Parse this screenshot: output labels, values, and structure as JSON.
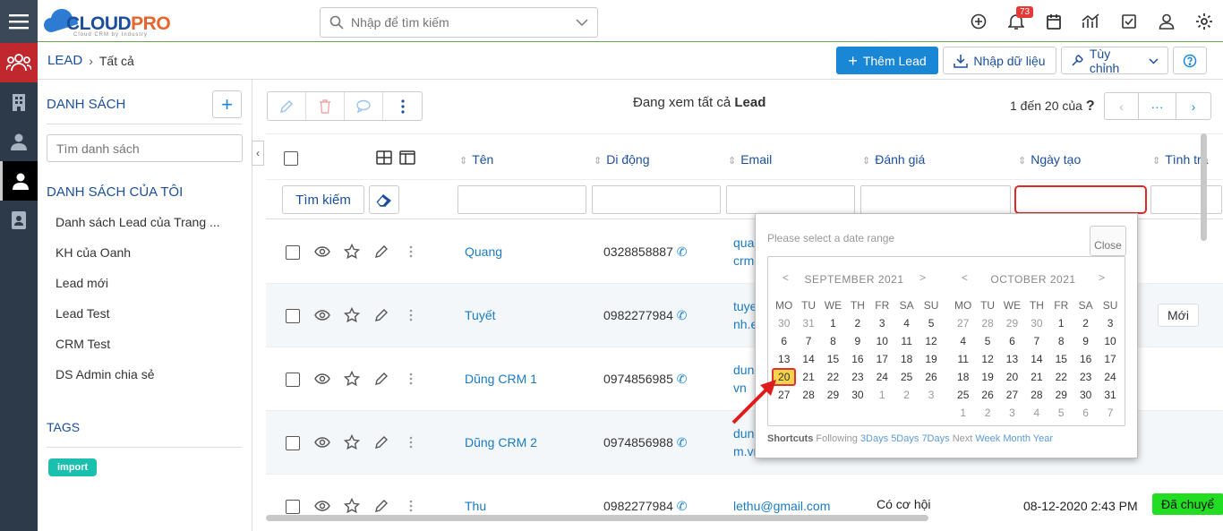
{
  "app": {
    "logo_main": "CLOUD",
    "logo_accent": "PRO",
    "logo_tagline": "Cloud CRM by Industry"
  },
  "search": {
    "placeholder": "Nhập để tìm kiếm"
  },
  "topbar": {
    "notification_count": "73"
  },
  "breadcrumb": {
    "root": "LEAD",
    "current": "Tất cả"
  },
  "toolbar": {
    "add_label": "Thêm Lead",
    "import_label": "Nhập dữ liệu",
    "custom_label": "Tùy chỉnh"
  },
  "sidebar": {
    "title": "DANH SÁCH",
    "search_placeholder": "Tìm danh sách",
    "my_lists_title": "DANH SÁCH CỦA TÔI",
    "items": [
      {
        "label": "Danh sách Lead của Trang ..."
      },
      {
        "label": "KH của Oanh"
      },
      {
        "label": "Lead mới"
      },
      {
        "label": "Lead Test"
      },
      {
        "label": "CRM Test"
      },
      {
        "label": "DS Admin chia sẻ"
      }
    ],
    "tags_title": "TAGS",
    "tag": "import"
  },
  "main": {
    "viewing_prefix": "Đang xem tất cả",
    "viewing_entity": "Lead",
    "pagination": "1 đến 20 của",
    "pagination_unknown": "?",
    "pagination_more": "···",
    "find_label": "Tìm kiếm"
  },
  "columns": {
    "name": "Tên",
    "mobile": "Di động",
    "email": "Email",
    "rating": "Đánh giá",
    "created": "Ngày tạo",
    "status": "Tình trạ"
  },
  "rows": [
    {
      "name": "Quang",
      "phone": "0328858887",
      "email1": "qua",
      "email2": "crm",
      "rating": "",
      "created": "",
      "status": ""
    },
    {
      "name": "Tuyết",
      "phone": "0982277984",
      "email1": "tuye",
      "email2": "nh.e",
      "rating": "",
      "created": "",
      "status": "Mới"
    },
    {
      "name": "Dũng CRM 1",
      "phone": "0974856985",
      "email1": "dun",
      "email2": "vn",
      "rating": "",
      "created": "",
      "status": ""
    },
    {
      "name": "Dũng CRM 2",
      "phone": "0974856988",
      "email1": "dun",
      "email2": "m.vn",
      "rating": "",
      "created": "",
      "status": ""
    },
    {
      "name": "Thu",
      "phone": "0982277984",
      "email1": "lethu@gmail.com",
      "email2": "",
      "rating": "Có cơ hội",
      "created": "08-12-2020 2:43 PM",
      "status": "Đã chuyể"
    }
  ],
  "datepicker": {
    "prompt": "Please select a date range",
    "close": "Close",
    "prev": "<",
    "next": ">",
    "weekdays": [
      "MO",
      "TU",
      "WE",
      "TH",
      "FR",
      "SA",
      "SU"
    ],
    "months": [
      {
        "title": "SEPTEMBER 2021",
        "days": [
          [
            "30",
            "off"
          ],
          [
            "31",
            "off"
          ],
          [
            "1",
            ""
          ],
          [
            "2",
            ""
          ],
          [
            "3",
            ""
          ],
          [
            "4",
            ""
          ],
          [
            "5",
            ""
          ],
          [
            "6",
            ""
          ],
          [
            "7",
            ""
          ],
          [
            "8",
            ""
          ],
          [
            "9",
            ""
          ],
          [
            "10",
            ""
          ],
          [
            "11",
            ""
          ],
          [
            "12",
            ""
          ],
          [
            "13",
            ""
          ],
          [
            "14",
            ""
          ],
          [
            "15",
            ""
          ],
          [
            "16",
            ""
          ],
          [
            "17",
            ""
          ],
          [
            "18",
            ""
          ],
          [
            "19",
            ""
          ],
          [
            "20",
            "sel"
          ],
          [
            "21",
            ""
          ],
          [
            "22",
            ""
          ],
          [
            "23",
            ""
          ],
          [
            "24",
            ""
          ],
          [
            "25",
            ""
          ],
          [
            "26",
            ""
          ],
          [
            "27",
            ""
          ],
          [
            "28",
            ""
          ],
          [
            "29",
            ""
          ],
          [
            "30",
            ""
          ],
          [
            "1",
            "off"
          ],
          [
            "2",
            "off"
          ],
          [
            "3",
            "off"
          ]
        ]
      },
      {
        "title": "OCTOBER 2021",
        "days": [
          [
            "27",
            "off"
          ],
          [
            "28",
            "off"
          ],
          [
            "29",
            "off"
          ],
          [
            "30",
            "off"
          ],
          [
            "1",
            ""
          ],
          [
            "2",
            ""
          ],
          [
            "3",
            ""
          ],
          [
            "4",
            ""
          ],
          [
            "5",
            ""
          ],
          [
            "6",
            ""
          ],
          [
            "7",
            ""
          ],
          [
            "8",
            ""
          ],
          [
            "9",
            ""
          ],
          [
            "10",
            ""
          ],
          [
            "11",
            ""
          ],
          [
            "12",
            ""
          ],
          [
            "13",
            ""
          ],
          [
            "14",
            ""
          ],
          [
            "15",
            ""
          ],
          [
            "16",
            ""
          ],
          [
            "17",
            ""
          ],
          [
            "18",
            ""
          ],
          [
            "19",
            ""
          ],
          [
            "20",
            ""
          ],
          [
            "21",
            ""
          ],
          [
            "22",
            ""
          ],
          [
            "23",
            ""
          ],
          [
            "24",
            ""
          ],
          [
            "25",
            ""
          ],
          [
            "26",
            ""
          ],
          [
            "27",
            ""
          ],
          [
            "28",
            ""
          ],
          [
            "29",
            ""
          ],
          [
            "30",
            ""
          ],
          [
            "31",
            ""
          ],
          [
            "1",
            "off"
          ],
          [
            "2",
            "off"
          ],
          [
            "3",
            "off"
          ],
          [
            "4",
            "off"
          ],
          [
            "5",
            "off"
          ],
          [
            "6",
            "off"
          ],
          [
            "7",
            "off"
          ]
        ]
      }
    ],
    "shortcuts_label": "Shortcuts",
    "following": "Following",
    "links": [
      "3Days",
      "5Days",
      "7Days"
    ],
    "next_word": "Next",
    "next_links": [
      "Week",
      "Month",
      "Year"
    ]
  },
  "colors": {
    "accent": "#1a86d6",
    "nav_bg": "#2d3a4a",
    "highlight": "#e02828"
  }
}
